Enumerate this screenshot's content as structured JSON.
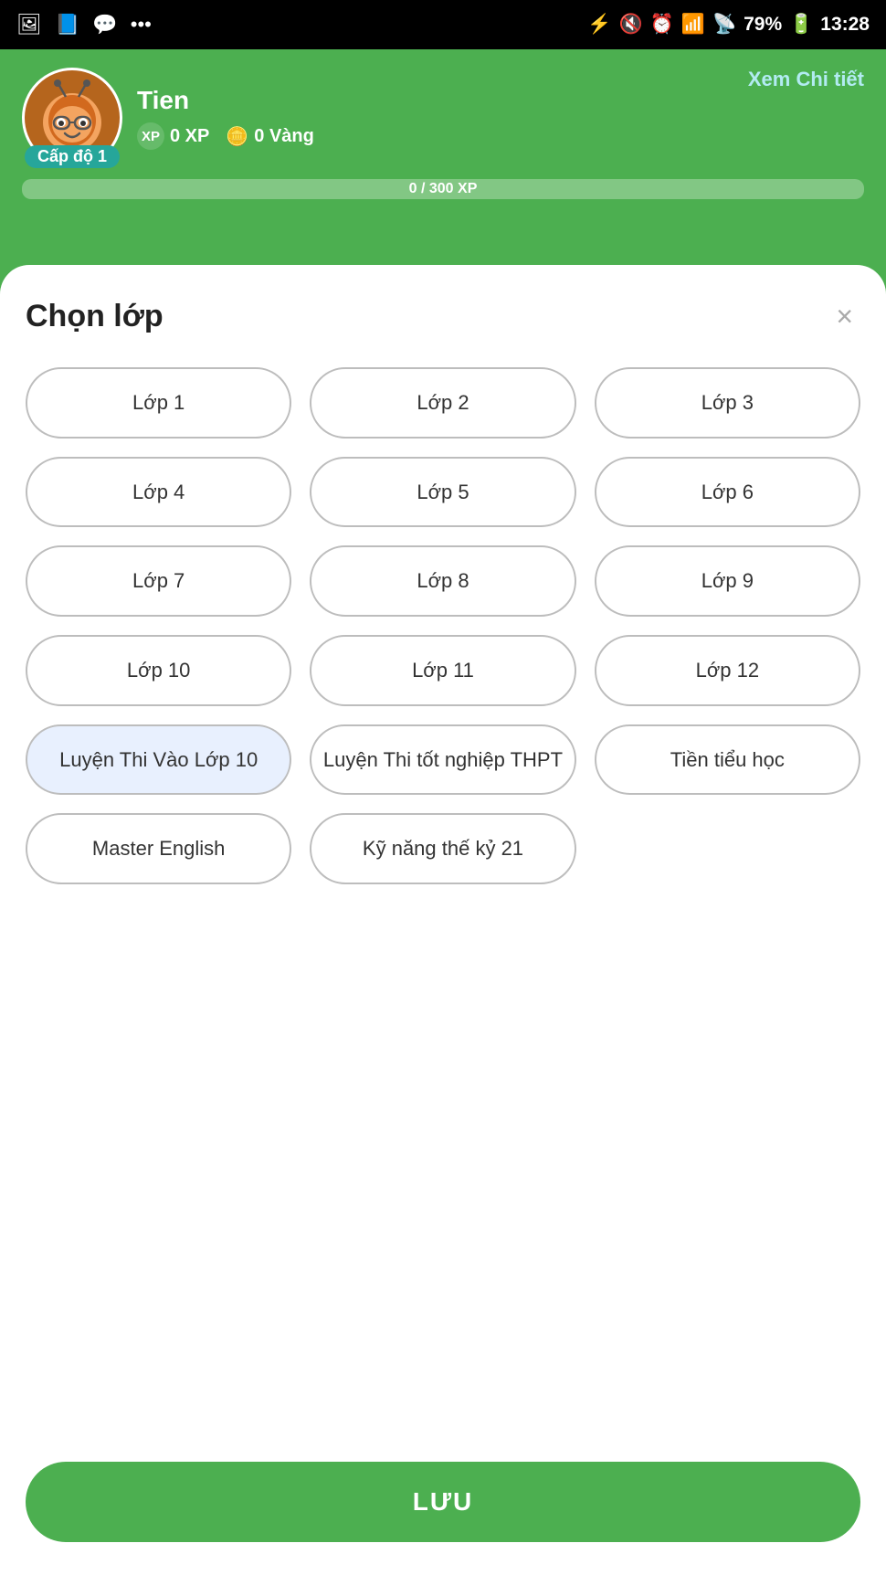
{
  "statusBar": {
    "time": "13:28",
    "battery": "79%",
    "icons": [
      "photo-icon",
      "facebook-icon",
      "messenger-icon",
      "more-icon",
      "bluetooth-icon",
      "mute-icon",
      "alarm-icon",
      "wifi-icon",
      "signal-icon",
      "battery-icon"
    ]
  },
  "profile": {
    "name": "Tien",
    "level": "Cấp độ 1",
    "xp": "0 XP",
    "gold": "0 Vàng",
    "xpProgress": "0 / 300 XP",
    "detailLink": "Xem Chi tiết"
  },
  "modal": {
    "title": "Chọn lớp",
    "closeLabel": "×",
    "grades": [
      {
        "id": "lop1",
        "label": "Lớp 1",
        "selected": false
      },
      {
        "id": "lop2",
        "label": "Lớp 2",
        "selected": false
      },
      {
        "id": "lop3",
        "label": "Lớp 3",
        "selected": false
      },
      {
        "id": "lop4",
        "label": "Lớp 4",
        "selected": false
      },
      {
        "id": "lop5",
        "label": "Lớp 5",
        "selected": false
      },
      {
        "id": "lop6",
        "label": "Lớp 6",
        "selected": false
      },
      {
        "id": "lop7",
        "label": "Lớp 7",
        "selected": false
      },
      {
        "id": "lop8",
        "label": "Lớp 8",
        "selected": false
      },
      {
        "id": "lop9",
        "label": "Lớp 9",
        "selected": false
      },
      {
        "id": "lop10",
        "label": "Lớp 10",
        "selected": false
      },
      {
        "id": "lop11",
        "label": "Lớp 11",
        "selected": false
      },
      {
        "id": "lop12",
        "label": "Lớp 12",
        "selected": false
      },
      {
        "id": "luyen-thi-vao-lop10",
        "label": "Luyện Thi Vào Lớp 10",
        "selected": true
      },
      {
        "id": "luyen-thi-tot-nghiep",
        "label": "Luyện Thi tốt nghiệp THPT",
        "selected": false
      },
      {
        "id": "tien-tieu-hoc",
        "label": "Tiền tiểu học",
        "selected": false
      },
      {
        "id": "master-english",
        "label": "Master English",
        "selected": false
      },
      {
        "id": "ky-nang-the-ky-21",
        "label": "Kỹ năng thế kỷ 21",
        "selected": false
      }
    ],
    "saveLabel": "LƯU"
  }
}
